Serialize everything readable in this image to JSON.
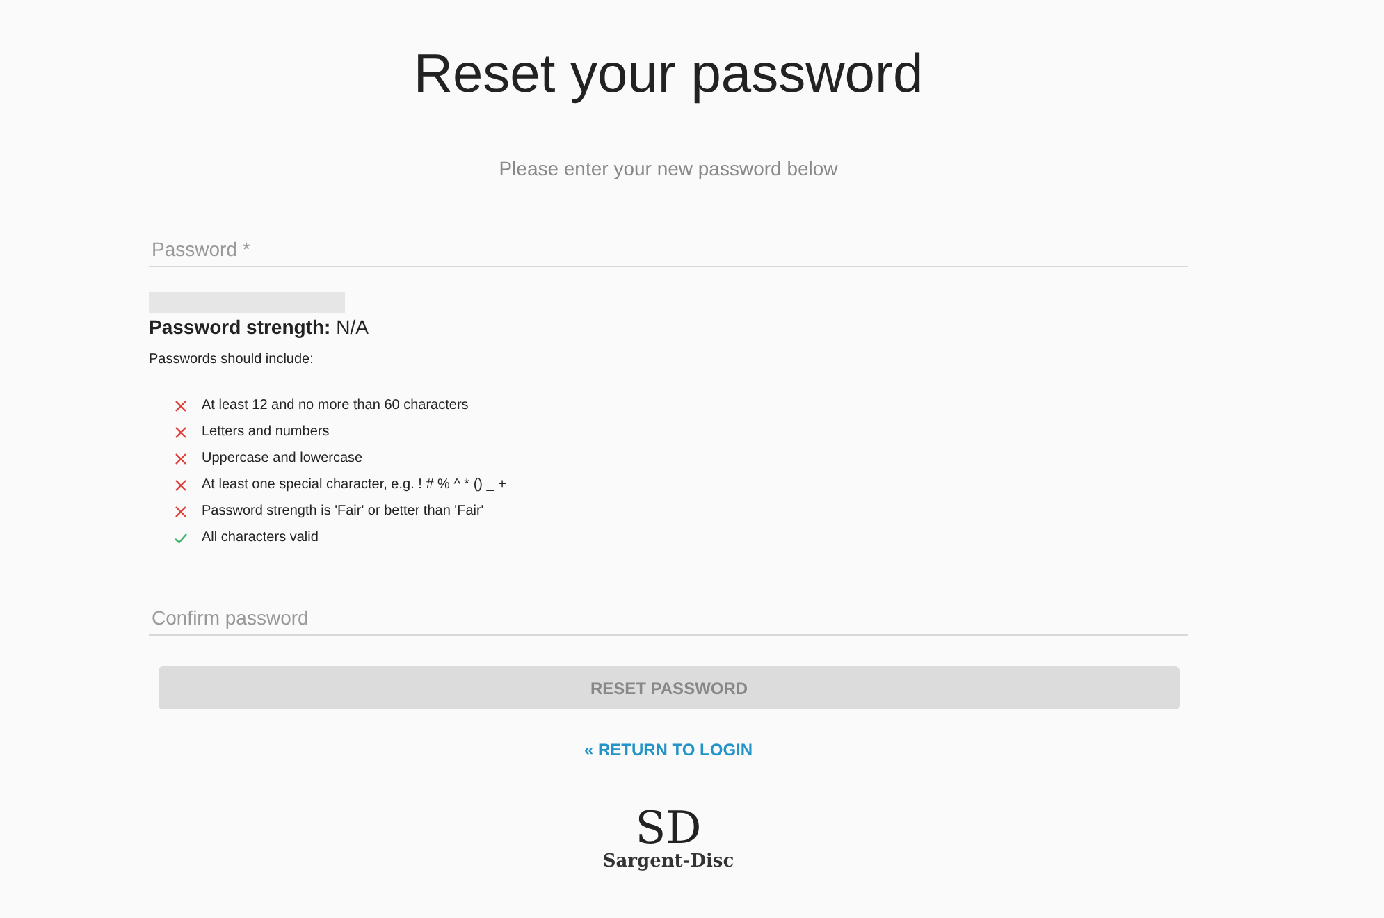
{
  "title": "Reset your password",
  "subtitle": "Please enter your new password below",
  "password_field": {
    "placeholder": "Password *"
  },
  "strength": {
    "level": 0,
    "label": "Password strength:",
    "value": "N/A"
  },
  "rules_heading": "Passwords should include:",
  "rules": [
    {
      "text": "At least 12 and no more than 60 characters",
      "met": false
    },
    {
      "text": "Letters and numbers",
      "met": false
    },
    {
      "text": "Uppercase and lowercase",
      "met": false
    },
    {
      "text": "At least one special character, e.g. ! # % ^ * () _ +",
      "met": false
    },
    {
      "text": "Password strength is 'Fair' or better than 'Fair'",
      "met": false
    },
    {
      "text": "All characters valid",
      "met": true
    }
  ],
  "confirm_field": {
    "placeholder": "Confirm password"
  },
  "reset_button": {
    "label": "RESET PASSWORD",
    "disabled": true
  },
  "return_link": "« RETURN TO LOGIN",
  "logo": {
    "mark": "SD",
    "name": "Sargent-Disc"
  }
}
